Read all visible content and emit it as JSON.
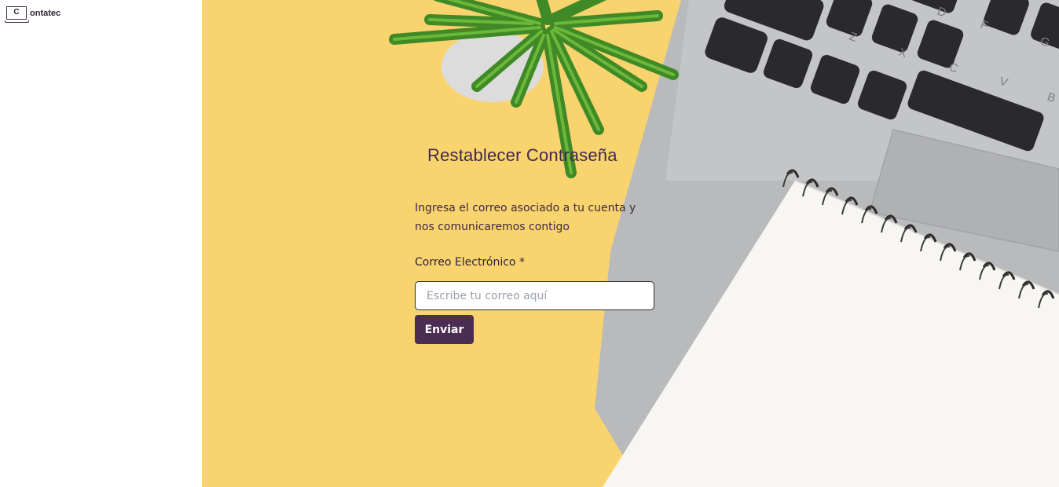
{
  "brand": {
    "logo_letter": "C",
    "name": "ontatec"
  },
  "page": {
    "title": "Restablecer Contraseña",
    "description": "Ingresa el correo asociado a tu cuenta y nos comunicaremos contigo",
    "email_label": "Correo Electrónico *",
    "email_placeholder": "Escribe tu correo aquí",
    "email_value": "",
    "submit_label": "Enviar"
  },
  "background": {
    "color": "#f9d46e",
    "keyboard_keys": [
      "D",
      "F",
      "G",
      "Z",
      "X",
      "C",
      "V",
      "B"
    ]
  },
  "colors": {
    "accent": "#4b2c52",
    "text": "#42294a"
  }
}
